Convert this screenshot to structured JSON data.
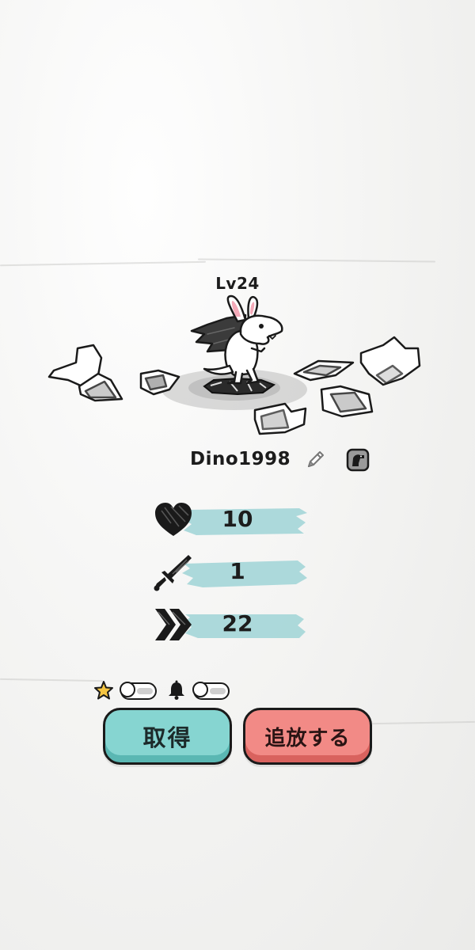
{
  "character": {
    "level": "Lv24",
    "name": "Dino1998"
  },
  "stats": [
    {
      "icon": "heart-icon",
      "value": "10"
    },
    {
      "icon": "sword-icon",
      "value": "1"
    },
    {
      "icon": "speed-chevron-icon",
      "value": "22"
    }
  ],
  "toggles": [
    {
      "icon": "star-icon",
      "state": "off"
    },
    {
      "icon": "bell-icon",
      "state": "off"
    }
  ],
  "actions": {
    "acquire_label": "取得",
    "banish_label": "追放する"
  },
  "colors": {
    "stat_brush": "#9fd3d6",
    "acquire_button": "#86d5d1",
    "banish_button": "#f28a86",
    "star": "#f5c542"
  }
}
